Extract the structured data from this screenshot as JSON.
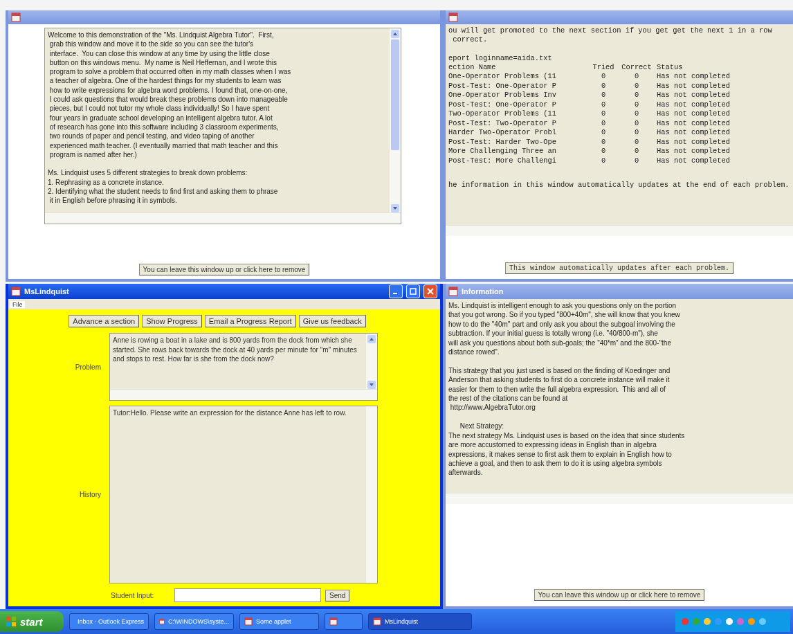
{
  "welcome_window": {
    "text": "Welcome to this demonstration of the \"Ms. Lindquist Algebra Tutor\".  First,\n grab this window and move it to the side so you can see the tutor's\n interface.  You can close this window at any time by using the little close\n button on this windows menu.  My name is Neil Heffernan, and I wrote this\n program to solve a problem that occurred often in my math classes when I was\n a teacher of algebra. One of the hardest things for my students to learn was\n how to write expressions for algebra word problems. I found that, one-on-one,\n I could ask questions that would break these problems down into manageable\n pieces, but I could not tutor my whole class individually! So I have spent\n four years in graduate school developing an intelligent algebra tutor. A lot\n of research has gone into this software including 3 classroom experiments,\n two rounds of paper and pencil testing, and video taping of another\n experienced math teacher. (I eventually married that math teacher and this\n program is named after her.)\n\nMs. Lindquist uses 5 different strategies to break down problems:\n1. Rephrasing as a concrete instance.\n2. Identifying what the student needs to find first and asking them to phrase\n it in English before phrasing it in symbols.",
    "button": "You can leave this window up or click here to remove"
  },
  "progress_window": {
    "intro": "ou will get promoted to the next section if you get get the next 1 in a row\n correct.",
    "report": "eport loginname=aida.txt",
    "columns": [
      "ection Name",
      "Tried",
      "Correct",
      "Status"
    ],
    "rows": [
      {
        "section": "One-Operator Problems (11",
        "tried": "0",
        "correct": "0",
        "status": "Has not completed"
      },
      {
        "section": "Post-Test: One-Operator P",
        "tried": "0",
        "correct": "0",
        "status": "Has not completed"
      },
      {
        "section": "One-Operator Problems Inv",
        "tried": "0",
        "correct": "0",
        "status": "Has not completed"
      },
      {
        "section": "Post-Test: One-Operator P",
        "tried": "0",
        "correct": "0",
        "status": "Has not completed"
      },
      {
        "section": "Two-Operator Problems (11",
        "tried": "0",
        "correct": "0",
        "status": "Has not completed"
      },
      {
        "section": "Post-Test: Two-Operator P",
        "tried": "0",
        "correct": "0",
        "status": "Has not completed"
      },
      {
        "section": "Harder Two-Operator Probl",
        "tried": "0",
        "correct": "0",
        "status": "Has not completed"
      },
      {
        "section": "Post-Test: Harder Two-Ope",
        "tried": "0",
        "correct": "0",
        "status": "Has not completed"
      },
      {
        "section": "More Challenging Three an",
        "tried": "0",
        "correct": "0",
        "status": "Has not completed"
      },
      {
        "section": "Post-Test: More Challengi",
        "tried": "0",
        "correct": "0",
        "status": "Has not completed"
      }
    ],
    "footer": "he information in this window automatically updates at the end of each problem.",
    "button": "This window automatically updates after each problem."
  },
  "tutor_window": {
    "title": "MsLindquist",
    "menu": [
      "File"
    ],
    "buttons": [
      "Advance a section",
      "Show Progress",
      "Email a Progress Report",
      "Give us feedback"
    ],
    "problem_label": "Problem",
    "problem_text": "Anne is rowing a boat in a lake and is 800 yards from the dock from which she started.  She rows back towards the dock at 40 yards per minute for \"m\" minutes and stops to rest.  How far is she from the dock now?",
    "history_label": "History",
    "history_text": "Tutor:Hello.  Please write an expression for the distance Anne has left to row.",
    "input_label": "Student Input:",
    "send_button": "Send"
  },
  "info_window": {
    "title": "Information",
    "text": "Ms. Lindquist is intelligent enough to ask you questions only on the portion\nthat you got wrong. So if you typed \"800+40m\", she will know that you knew\nhow to do the \"40m\" part and only ask you about the subgoal involving the\nsubtraction. If your initial guess is totally wrong (i.e. \"40/800-m\"), she\nwill ask you questions about both sub-goals; the \"40*m\" and the 800-\"the\ndistance rowed\".\n\nThis strategy that you just used is based on the finding of Koedinger and\nAnderson that asking students to first do a concrete instance will make it\neasier for them to then write the full algebra expression.  This and all of\nthe rest of the citations can be found at\n http://www.AlgebraTutor.org\n\n      Next Strategy:\nThe next strategy Ms. Lindquist uses is based on the idea that since students\nare more accustomed to expressing ideas in English than in algebra\nexpressions, it makes sense to first ask them to explain in English how to\nachieve a goal, and then to ask them to do it is using algebra symbols\nafterwards.",
    "button": "You can leave this window up or click here to remove"
  },
  "taskbar": {
    "start": "start",
    "items": [
      {
        "label": "Inbox - Outlook Express",
        "selected": false
      },
      {
        "label": "C:\\WINDOWS\\syste...",
        "selected": false
      },
      {
        "label": "Some applet",
        "selected": false
      },
      {
        "selected": false
      },
      {
        "label": "MsLindquist",
        "selected": true
      }
    ]
  }
}
